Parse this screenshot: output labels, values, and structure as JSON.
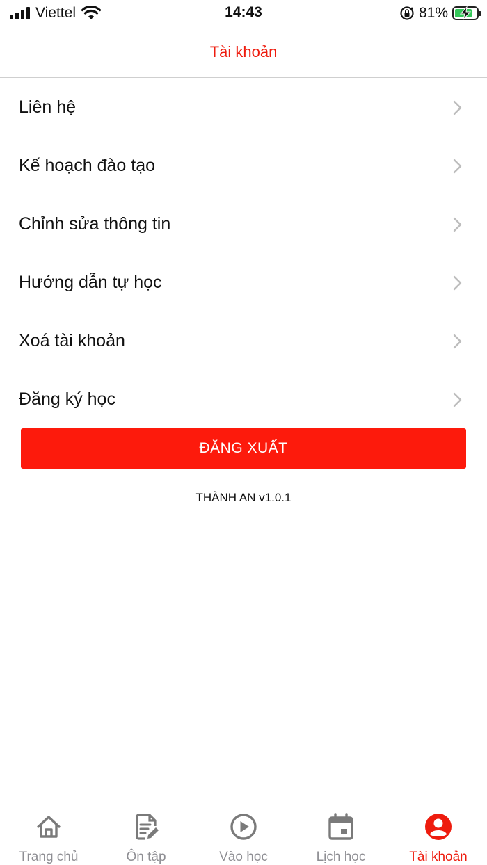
{
  "status_bar": {
    "carrier": "Viettel",
    "time": "14:43",
    "battery_percent": "81%",
    "battery_level": 0.81,
    "battery_charging": true,
    "accent_battery": "#34c759"
  },
  "header": {
    "title": "Tài khoản"
  },
  "menu": {
    "items": [
      {
        "label": "Liên hệ",
        "icon": "chevron-right-icon"
      },
      {
        "label": "Kế hoạch đào tạo",
        "icon": "chevron-right-icon"
      },
      {
        "label": "Chỉnh sửa thông tin",
        "icon": "chevron-right-icon"
      },
      {
        "label": "Hướng dẫn tự học",
        "icon": "chevron-right-icon"
      },
      {
        "label": "Xoá tài khoản",
        "icon": "chevron-right-icon"
      },
      {
        "label": "Đăng ký học",
        "icon": "chevron-right-icon"
      }
    ]
  },
  "logout": {
    "label": "ĐĂNG XUẤT",
    "color": "#fd1a0c"
  },
  "version_text": "THÀNH AN v1.0.1",
  "tabs": [
    {
      "label": "Trang chủ",
      "icon": "home-icon",
      "active": false
    },
    {
      "label": "Ôn tập",
      "icon": "note-edit-icon",
      "active": false
    },
    {
      "label": "Vào học",
      "icon": "play-circle-icon",
      "active": false
    },
    {
      "label": "Lịch học",
      "icon": "calendar-icon",
      "active": false
    },
    {
      "label": "Tài khoản",
      "icon": "account-circle-icon",
      "active": true
    }
  ],
  "colors": {
    "accent": "#ee1c0e",
    "inactive_tab": "#8e8e93"
  }
}
